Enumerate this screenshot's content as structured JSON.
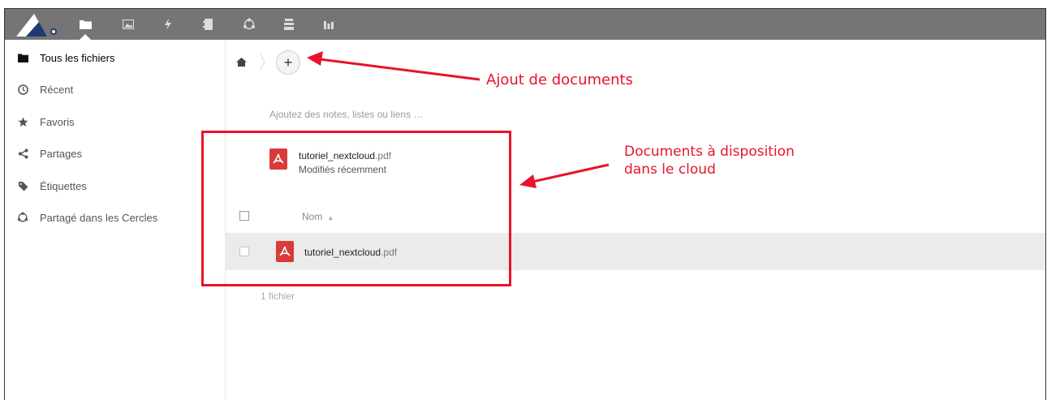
{
  "topbar": {
    "bg_color": "#757575",
    "apps": [
      {
        "name": "files",
        "icon": "folder-icon",
        "active": true
      },
      {
        "name": "photos",
        "icon": "image-icon"
      },
      {
        "name": "activity",
        "icon": "lightning-icon"
      },
      {
        "name": "contacts",
        "icon": "contacts-icon"
      },
      {
        "name": "circles",
        "icon": "circles-icon"
      },
      {
        "name": "deck",
        "icon": "stack-icon"
      },
      {
        "name": "stats",
        "icon": "bar-chart-icon"
      }
    ]
  },
  "sidebar": {
    "items": [
      {
        "label": "Tous les fichiers",
        "icon": "folder-icon",
        "active": true
      },
      {
        "label": "Récent",
        "icon": "clock-icon"
      },
      {
        "label": "Favoris",
        "icon": "star-icon"
      },
      {
        "label": "Partages",
        "icon": "share-icon"
      },
      {
        "label": "Étiquettes",
        "icon": "tag-icon"
      },
      {
        "label": "Partagé dans les Cercles",
        "icon": "circles-icon"
      }
    ]
  },
  "main": {
    "notes_placeholder": "Ajoutez des notes, listes ou liens …",
    "recent": {
      "file_base": "tutoriel_nextcloud",
      "file_ext": ".pdf",
      "subtitle": "Modifiés récemment"
    },
    "table": {
      "column_name": "Nom",
      "rows": [
        {
          "file_base": "tutoriel_nextcloud",
          "file_ext": ".pdf"
        }
      ],
      "summary": "1 fichier"
    }
  },
  "annotations": {
    "color": "#e8132b",
    "add_label": "Ajout de documents",
    "docs_label_line1": "Documents à disposition",
    "docs_label_line2": "dans le cloud"
  }
}
